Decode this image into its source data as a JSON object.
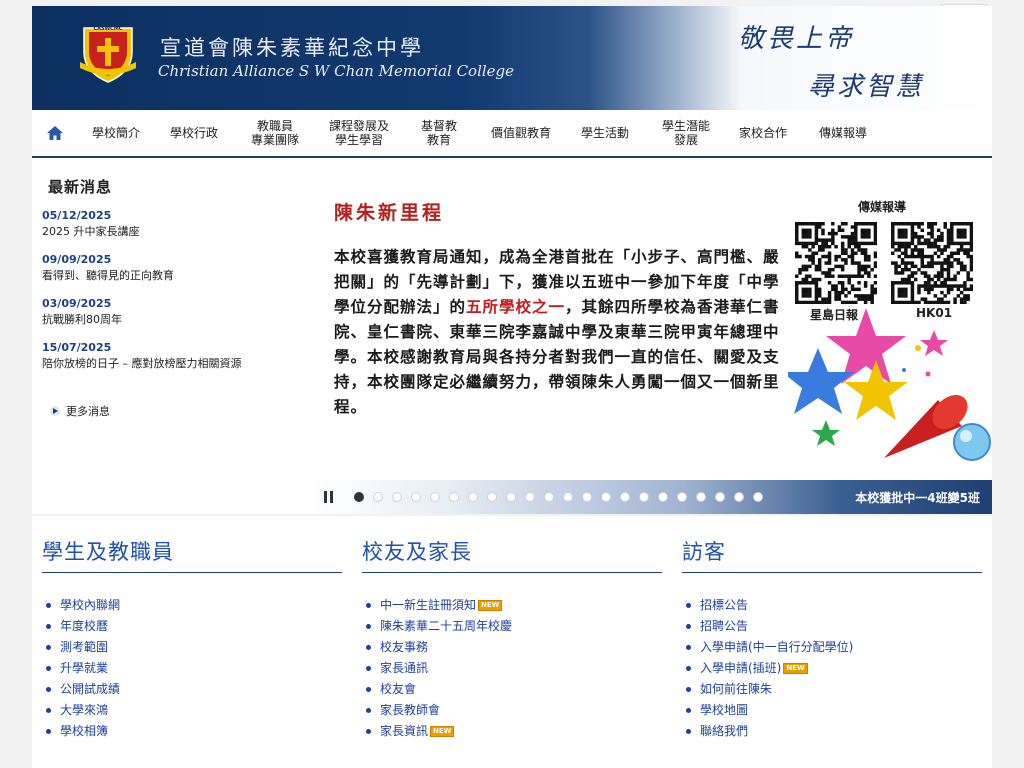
{
  "font_switcher": [
    "A",
    "A",
    "A"
  ],
  "header": {
    "logo_text": "CASWCMC",
    "school_name_zh": "宣道會陳朱素華紀念中學",
    "school_name_en": "Christian Alliance S W Chan Memorial College",
    "motto_line1": "敬畏上帝",
    "motto_line2": "尋求智慧"
  },
  "nav": {
    "home_icon": "home-icon",
    "items": [
      "學校簡介",
      "學校行政",
      "教職員\n專業團隊",
      "課程發展及\n學生學習",
      "基督教\n教育",
      "價值觀教育",
      "學生活動",
      "學生潛能\n發展",
      "家校合作",
      "傳媒報導"
    ]
  },
  "news": {
    "heading": "最新消息",
    "items": [
      {
        "date": "05/12/2025",
        "title": "2025 升中家長講座"
      },
      {
        "date": "09/09/2025",
        "title": "看得到、聽得見的正向教育"
      },
      {
        "date": "03/09/2025",
        "title": "抗戰勝利80周年"
      },
      {
        "date": "15/07/2025",
        "title": "陪你放榜的日子 – 應對放榜壓力相關資源"
      }
    ],
    "more": "更多消息"
  },
  "slide": {
    "title": "陳朱新里程",
    "body_before": "本校喜獲教育局通知，成為全港首批在「小步子、高門檻、嚴把關」的「先導計劃」下，獲准以五班中一參加下年度「中學學位分配辦法」的",
    "body_highlight": "五所學校之一",
    "body_after": "，其餘四所學校為香港華仁書院、皇仁書院、東華三院李嘉誠中學及東華三院甲寅年總理中學。本校感謝教育局與各持分者對我們一直的信任、關愛及支持，本校團隊定必繼續努力，帶領陳朱人勇闖一個又一個新里程。",
    "media_label": "傳媒報導",
    "qr1_label": "星島日報",
    "qr2_label": "HK01",
    "caption": "本校獲批中一4班變5班",
    "dot_count": 22,
    "active_dot": 1
  },
  "sections": {
    "students": {
      "heading": "學生及教職員",
      "links": [
        "學校內聯網",
        "年度校曆",
        "測考範圍",
        "升學就業",
        "公開試成績",
        "大學來鴻",
        "學校相簿"
      ]
    },
    "alumni": {
      "heading": "校友及家長",
      "links": [
        "中一新生註冊須知",
        "陳朱素華二十五周年校慶",
        "校友事務",
        "家長通訊",
        "校友會",
        "家長教師會",
        "家長資訊"
      ],
      "new_flags": [
        true,
        false,
        false,
        false,
        false,
        false,
        true
      ]
    },
    "visitors": {
      "heading": "訪客",
      "links": [
        "招標公告",
        "招聘公告",
        "入學申請(中一自行分配學位)",
        "入學申請(插班)",
        "如何前往陳朱",
        "學校地圖",
        "聯絡我們"
      ],
      "new_flags": [
        false,
        false,
        false,
        true,
        false,
        false,
        false
      ]
    }
  },
  "new_badge_text": "NEW",
  "colors": {
    "navy": "#0c2f5f",
    "link_blue": "#1f3f9a",
    "heading_blue": "#1f4fb0",
    "highlight_red": "#c8191e"
  }
}
